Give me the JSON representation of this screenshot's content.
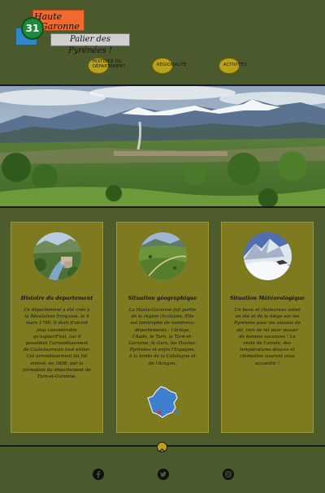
{
  "logo": {
    "number": "31",
    "line1": "Haute",
    "line2": "Garonne",
    "tagline": "Palier des Pyrénées !"
  },
  "nav": [
    {
      "label": "HISTOIRE DU DÉPARTEMENT"
    },
    {
      "label": "RÉGIONALITÉ"
    },
    {
      "label": "ACTIVITÉS"
    }
  ],
  "cards": [
    {
      "title": "Histoire du departement",
      "text": "Ce département a été créé à la Révolution française, le 4 mars 1790. Il était d'abord plus considérable qu'aujourd'hui, car il possédait l'arrondissement de Castelsarrasin tout entier. Cet arrondissement lui fut enlevé, en 1808, par la formation du département de Tarn-et-Garonne.",
      "photo": "river-town-photo"
    },
    {
      "title": "Situation géographique",
      "text": "La Haute-Garonne fait partie de la région Occitanie. Elle est limitrophe de nombreux départements : l'Ariège, l'Aude, le Tarn, le Tarn-et-Garonne, le Gers, les Hautes-Pyrénées et enfin l'Espagne, à la limite de la Catalogne et de l'Aragon.",
      "photo": "green-hills-photo"
    },
    {
      "title": "Situation Météorologique",
      "text": "Un beau et chaleureux soleil en été et de la neige sur les Pyrénées pour les saisons de ski, rien de tel pour passer de bonnes vacances ! Le reste de l'année, des températures douces et clémentes vouront vous accueillir !",
      "photo": "snowy-mountain-photo"
    }
  ],
  "footer": {
    "social": [
      "facebook-icon",
      "twitter-icon",
      "instagram-icon"
    ],
    "back_to_top": "chevron-up-icon"
  },
  "colors": {
    "background": "#4b5a2c",
    "card": "#7d7a1f",
    "nav_dot": "#b9a11a"
  }
}
